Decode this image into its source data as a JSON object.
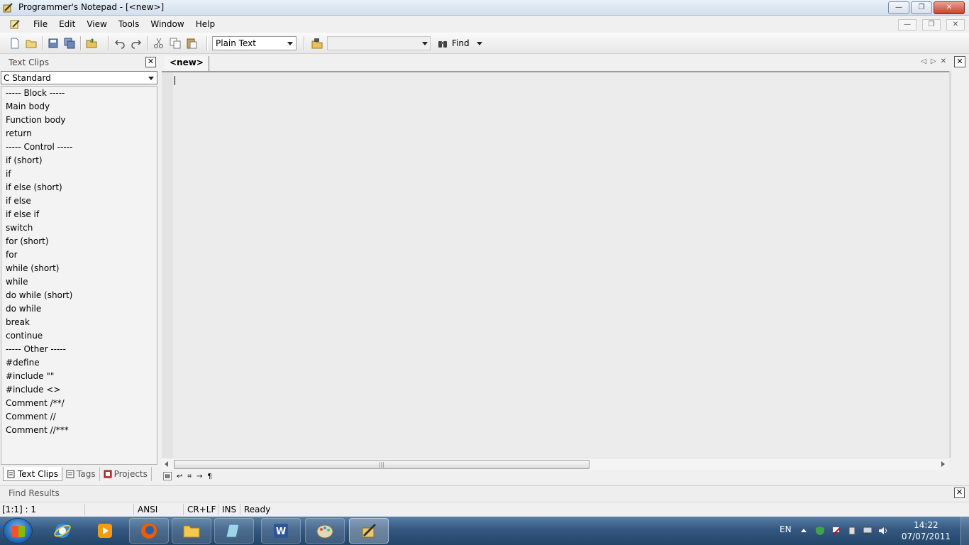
{
  "window": {
    "title": "Programmer's Notepad - [<new>]",
    "minimize": "—",
    "restore": "❐",
    "close": "✕"
  },
  "menu": {
    "items": [
      "File",
      "Edit",
      "View",
      "Tools",
      "Window",
      "Help"
    ],
    "mdi_minimize": "—",
    "mdi_restore": "❐",
    "mdi_close": "✕"
  },
  "toolbar": {
    "scheme": "Plain Text",
    "find_label": "Find",
    "find_value": ""
  },
  "text_clips": {
    "title": "Text Clips",
    "selected_set": "C Standard",
    "items": [
      "----- Block -----",
      "Main body",
      "Function body",
      "return",
      "----- Control -----",
      "if (short)",
      "if",
      "if else (short)",
      "if else",
      "if else if",
      "switch",
      "for (short)",
      "for",
      "while (short)",
      "while",
      "do while (short)",
      "do while",
      "break",
      "continue",
      "----- Other -----",
      "#define",
      "#include \"\"",
      "#include <>",
      "Comment /**/",
      "Comment //",
      "Comment //***"
    ],
    "tabs": [
      "Text Clips",
      "Tags",
      "Projects"
    ]
  },
  "editor": {
    "tab_label": "<new>",
    "content": ""
  },
  "find_results": {
    "title": "Find Results"
  },
  "status": {
    "position": "[1:1] : 1",
    "encoding": "ANSI",
    "line_endings": "CR+LF",
    "mode": "INS",
    "state": "Ready"
  },
  "taskbar": {
    "language": "EN",
    "time": "14:22",
    "date": "07/07/2011"
  },
  "colors": {
    "taskbar": "#34587f",
    "titlebar": "#d4e0ee",
    "editor_bg": "#ececec"
  }
}
